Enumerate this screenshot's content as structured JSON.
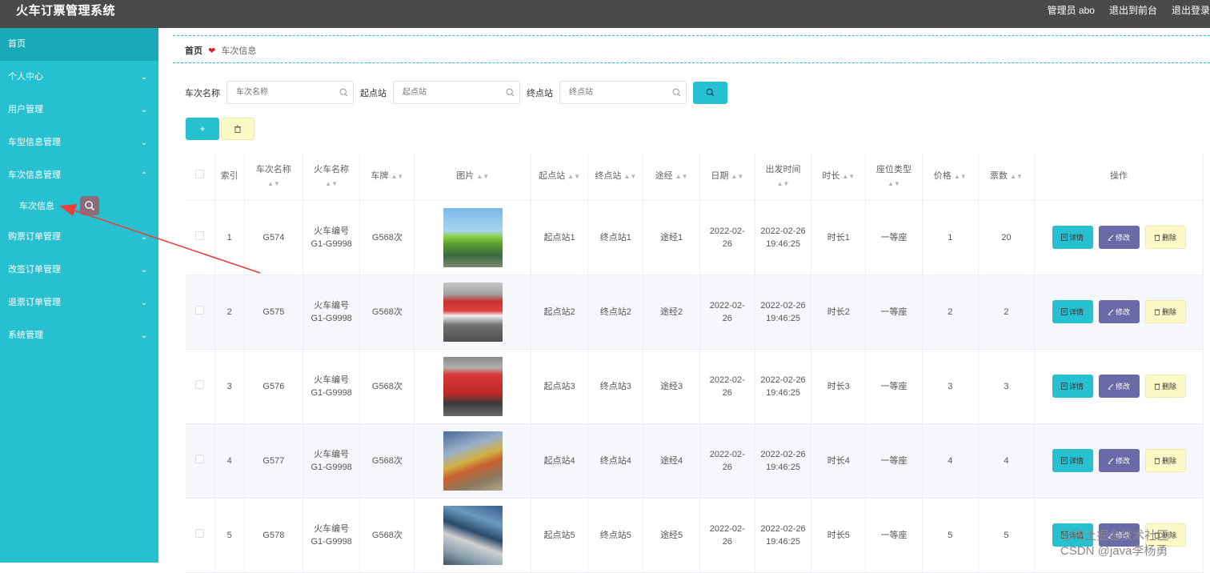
{
  "app": {
    "title": "火车订票管理系统"
  },
  "topbar": {
    "admin": "管理员 abo",
    "to_front": "退出到前台",
    "logout": "退出登录"
  },
  "sidebar": {
    "items": [
      {
        "label": "首页",
        "chevron": ""
      },
      {
        "label": "个人中心",
        "chevron": "⌄"
      },
      {
        "label": "用户管理",
        "chevron": "⌄"
      },
      {
        "label": "车型信息管理",
        "chevron": "⌄"
      },
      {
        "label": "车次信息管理",
        "chevron": "⌃"
      },
      {
        "label": "购票订单管理",
        "chevron": "⌄"
      },
      {
        "label": "改签订单管理",
        "chevron": "⌄"
      },
      {
        "label": "退票订单管理",
        "chevron": "⌄"
      },
      {
        "label": "系统管理",
        "chevron": "⌄"
      }
    ],
    "sub_item": "车次信息"
  },
  "breadcrumb": {
    "home": "首页",
    "separator": "❤",
    "current": "车次信息"
  },
  "search": {
    "train_name_label": "车次名称",
    "train_name_placeholder": "车次名称",
    "start_label": "起点站",
    "start_placeholder": "起点站",
    "end_label": "终点站",
    "end_placeholder": "终点站"
  },
  "actions": {
    "add": "+"
  },
  "table": {
    "headers": {
      "index": "索引",
      "train_name": "车次名称",
      "train_model": "火车名称",
      "plate": "车牌",
      "image": "图片",
      "start": "起点站",
      "end": "终点站",
      "via": "途经",
      "date": "日期",
      "depart": "出发时间",
      "duration": "时长",
      "seat": "座位类型",
      "price": "价格",
      "tickets": "票数",
      "ops": "操作"
    },
    "ops": {
      "detail": "详情",
      "edit": "修改",
      "delete": "删除"
    },
    "rows": [
      {
        "index": "1",
        "train_name": "G574",
        "train_model": "火车编号G1-G9998",
        "plate": "G568次",
        "image": "train-photo-1",
        "start": "起点站1",
        "end": "终点站1",
        "via": "途经1",
        "date": "2022-02-26",
        "depart": "2022-02-26 19:46:25",
        "duration": "时长1",
        "seat": "一等座",
        "price": "1",
        "tickets": "20"
      },
      {
        "index": "2",
        "train_name": "G575",
        "train_model": "火车编号G1-G9998",
        "plate": "G568次",
        "image": "train-photo-2",
        "start": "起点站2",
        "end": "终点站2",
        "via": "途经2",
        "date": "2022-02-26",
        "depart": "2022-02-26 19:46:25",
        "duration": "时长2",
        "seat": "一等座",
        "price": "2",
        "tickets": "2"
      },
      {
        "index": "3",
        "train_name": "G576",
        "train_model": "火车编号G1-G9998",
        "plate": "G568次",
        "image": "train-photo-3",
        "start": "起点站3",
        "end": "终点站3",
        "via": "途经3",
        "date": "2022-02-26",
        "depart": "2022-02-26 19:46:25",
        "duration": "时长3",
        "seat": "一等座",
        "price": "3",
        "tickets": "3"
      },
      {
        "index": "4",
        "train_name": "G577",
        "train_model": "火车编号G1-G9998",
        "plate": "G568次",
        "image": "train-photo-4",
        "start": "起点站4",
        "end": "终点站4",
        "via": "途经4",
        "date": "2022-02-26",
        "depart": "2022-02-26 19:46:25",
        "duration": "时长4",
        "seat": "一等座",
        "price": "4",
        "tickets": "4"
      },
      {
        "index": "5",
        "train_name": "G578",
        "train_model": "火车编号G1-G9998",
        "plate": "G568次",
        "image": "train-photo-5",
        "start": "起点站5",
        "end": "终点站5",
        "via": "途经5",
        "date": "2022-02-26",
        "depart": "2022-02-26 19:46:25",
        "duration": "时长5",
        "seat": "一等座",
        "price": "5",
        "tickets": "5"
      }
    ]
  },
  "watermark": {
    "line1": "@稀土掘金技术社区",
    "line2": "CSDN @java李杨勇"
  },
  "colors": {
    "accent": "#26c0d0",
    "topbar": "#4a4a4a",
    "edit": "#6b6aa8",
    "delete": "#fdfac8",
    "annotation": "#e8403a"
  }
}
